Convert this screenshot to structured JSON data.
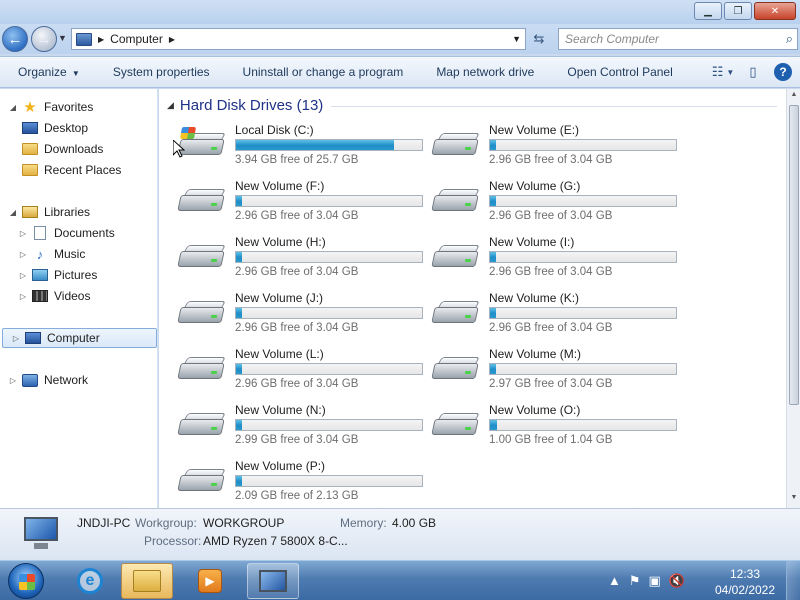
{
  "address": {
    "crumb": "Computer"
  },
  "search": {
    "placeholder": "Search Computer"
  },
  "toolbar": {
    "organize": "Organize",
    "system_properties": "System properties",
    "uninstall": "Uninstall or change a program",
    "map_drive": "Map network drive",
    "control_panel": "Open Control Panel"
  },
  "nav": {
    "favorites": "Favorites",
    "desktop": "Desktop",
    "downloads": "Downloads",
    "recent": "Recent Places",
    "libraries": "Libraries",
    "documents": "Documents",
    "music": "Music",
    "pictures": "Pictures",
    "videos": "Videos",
    "computer": "Computer",
    "network": "Network"
  },
  "group": {
    "title": "Hard Disk Drives (13)"
  },
  "drives": [
    {
      "name": "Local Disk (C:)",
      "free": "3.94 GB free of 25.7 GB",
      "used_fraction": 0.85
    },
    {
      "name": "New Volume (E:)",
      "free": "2.96 GB free of 3.04 GB",
      "used_fraction": 0.03
    },
    {
      "name": "New Volume (F:)",
      "free": "2.96 GB free of 3.04 GB",
      "used_fraction": 0.03
    },
    {
      "name": "New Volume (G:)",
      "free": "2.96 GB free of 3.04 GB",
      "used_fraction": 0.03
    },
    {
      "name": "New Volume (H:)",
      "free": "2.96 GB free of 3.04 GB",
      "used_fraction": 0.03
    },
    {
      "name": "New Volume (I:)",
      "free": "2.96 GB free of 3.04 GB",
      "used_fraction": 0.03
    },
    {
      "name": "New Volume (J:)",
      "free": "2.96 GB free of 3.04 GB",
      "used_fraction": 0.03
    },
    {
      "name": "New Volume (K:)",
      "free": "2.96 GB free of 3.04 GB",
      "used_fraction": 0.03
    },
    {
      "name": "New Volume (L:)",
      "free": "2.96 GB free of 3.04 GB",
      "used_fraction": 0.03
    },
    {
      "name": "New Volume (M:)",
      "free": "2.97 GB free of 3.04 GB",
      "used_fraction": 0.03
    },
    {
      "name": "New Volume (N:)",
      "free": "2.99 GB free of 3.04 GB",
      "used_fraction": 0.03
    },
    {
      "name": "New Volume (O:)",
      "free": "1.00 GB free of 1.04 GB",
      "used_fraction": 0.04
    },
    {
      "name": "New Volume (P:)",
      "free": "2.09 GB free of 2.13 GB",
      "used_fraction": 0.03
    }
  ],
  "details": {
    "pc_name": "JNDJI-PC",
    "workgroup_label": "Workgroup:",
    "workgroup_value": "WORKGROUP",
    "memory_label": "Memory:",
    "memory_value": "4.00 GB",
    "processor_label": "Processor:",
    "processor_value": "AMD Ryzen 7 5800X 8-C..."
  },
  "taskbar": {
    "time": "12:33",
    "date": "04/02/2022"
  },
  "colors": {
    "accent": "#1f8dc7",
    "group_title": "#1e3287",
    "taskbar": "#4e7bb0"
  }
}
